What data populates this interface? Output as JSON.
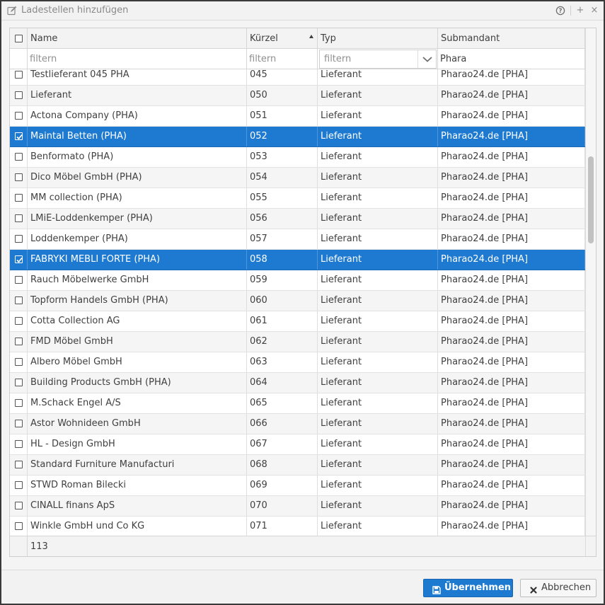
{
  "dialog": {
    "title": "Ladestellen hinzufügen",
    "help_symbol": "?",
    "plus_symbol": "+",
    "close_symbol": "×"
  },
  "grid": {
    "columns": [
      {
        "key": "name",
        "label": "Name"
      },
      {
        "key": "kuerzel",
        "label": "Kürzel",
        "sorted": "asc"
      },
      {
        "key": "typ",
        "label": "Typ"
      },
      {
        "key": "submandant",
        "label": "Submandant"
      }
    ],
    "filters": {
      "name_placeholder": "filtern",
      "kuerzel_placeholder": "filtern",
      "typ_placeholder": "filtern",
      "submandant_value": "Phara"
    },
    "rows": [
      {
        "name": "Testlieferant 045 PHA",
        "kuerzel": "045",
        "typ": "Lieferant",
        "submandant": "Pharao24.de [PHA]",
        "selected": false
      },
      {
        "name": "Lieferant",
        "kuerzel": "050",
        "typ": "Lieferant",
        "submandant": "Pharao24.de [PHA]",
        "selected": false
      },
      {
        "name": "Actona Company (PHA)",
        "kuerzel": "051",
        "typ": "Lieferant",
        "submandant": "Pharao24.de [PHA]",
        "selected": false
      },
      {
        "name": "Maintal Betten (PHA)",
        "kuerzel": "052",
        "typ": "Lieferant",
        "submandant": "Pharao24.de [PHA]",
        "selected": true
      },
      {
        "name": "Benformato (PHA)",
        "kuerzel": "053",
        "typ": "Lieferant",
        "submandant": "Pharao24.de [PHA]",
        "selected": false
      },
      {
        "name": "Dico Möbel GmbH (PHA)",
        "kuerzel": "054",
        "typ": "Lieferant",
        "submandant": "Pharao24.de [PHA]",
        "selected": false
      },
      {
        "name": "MM collection (PHA)",
        "kuerzel": "055",
        "typ": "Lieferant",
        "submandant": "Pharao24.de [PHA]",
        "selected": false
      },
      {
        "name": "LMiE-Loddenkemper (PHA)",
        "kuerzel": "056",
        "typ": "Lieferant",
        "submandant": "Pharao24.de [PHA]",
        "selected": false
      },
      {
        "name": "Loddenkemper (PHA)",
        "kuerzel": "057",
        "typ": "Lieferant",
        "submandant": "Pharao24.de [PHA]",
        "selected": false
      },
      {
        "name": "FABRYKI MEBLI FORTE (PHA)",
        "kuerzel": "058",
        "typ": "Lieferant",
        "submandant": "Pharao24.de [PHA]",
        "selected": true
      },
      {
        "name": "Rauch Möbelwerke GmbH",
        "kuerzel": "059",
        "typ": "Lieferant",
        "submandant": "Pharao24.de [PHA]",
        "selected": false
      },
      {
        "name": "Topform Handels GmbH (PHA)",
        "kuerzel": "060",
        "typ": "Lieferant",
        "submandant": "Pharao24.de [PHA]",
        "selected": false
      },
      {
        "name": "Cotta Collection AG",
        "kuerzel": "061",
        "typ": "Lieferant",
        "submandant": "Pharao24.de [PHA]",
        "selected": false
      },
      {
        "name": "FMD Möbel GmbH",
        "kuerzel": "062",
        "typ": "Lieferant",
        "submandant": "Pharao24.de [PHA]",
        "selected": false
      },
      {
        "name": "Albero Möbel GmbH",
        "kuerzel": "063",
        "typ": "Lieferant",
        "submandant": "Pharao24.de [PHA]",
        "selected": false
      },
      {
        "name": "Building Products GmbH (PHA)",
        "kuerzel": "064",
        "typ": "Lieferant",
        "submandant": "Pharao24.de [PHA]",
        "selected": false
      },
      {
        "name": "M.Schack Engel A/S",
        "kuerzel": "065",
        "typ": "Lieferant",
        "submandant": "Pharao24.de [PHA]",
        "selected": false
      },
      {
        "name": "Astor Wohnideen GmbH",
        "kuerzel": "066",
        "typ": "Lieferant",
        "submandant": "Pharao24.de [PHA]",
        "selected": false
      },
      {
        "name": "HL - Design GmbH",
        "kuerzel": "067",
        "typ": "Lieferant",
        "submandant": "Pharao24.de [PHA]",
        "selected": false
      },
      {
        "name": "Standard Furniture Manufacturi",
        "kuerzel": "068",
        "typ": "Lieferant",
        "submandant": "Pharao24.de [PHA]",
        "selected": false
      },
      {
        "name": "STWD Roman Bilecki",
        "kuerzel": "069",
        "typ": "Lieferant",
        "submandant": "Pharao24.de [PHA]",
        "selected": false
      },
      {
        "name": "CINALL finans ApS",
        "kuerzel": "070",
        "typ": "Lieferant",
        "submandant": "Pharao24.de [PHA]",
        "selected": false
      },
      {
        "name": "Winkle GmbH und Co KG",
        "kuerzel": "071",
        "typ": "Lieferant",
        "submandant": "Pharao24.de [PHA]",
        "selected": false
      }
    ],
    "total_count": "113"
  },
  "actions": {
    "accept_label": "Übernehmen",
    "cancel_label": "Abbrechen"
  },
  "colors": {
    "selection": "#1e7ad0",
    "row_alt": "#f5f5f5"
  },
  "icons": {
    "title": "edit-icon",
    "accept": "floppy-disk-icon",
    "cancel": "close-icon"
  }
}
